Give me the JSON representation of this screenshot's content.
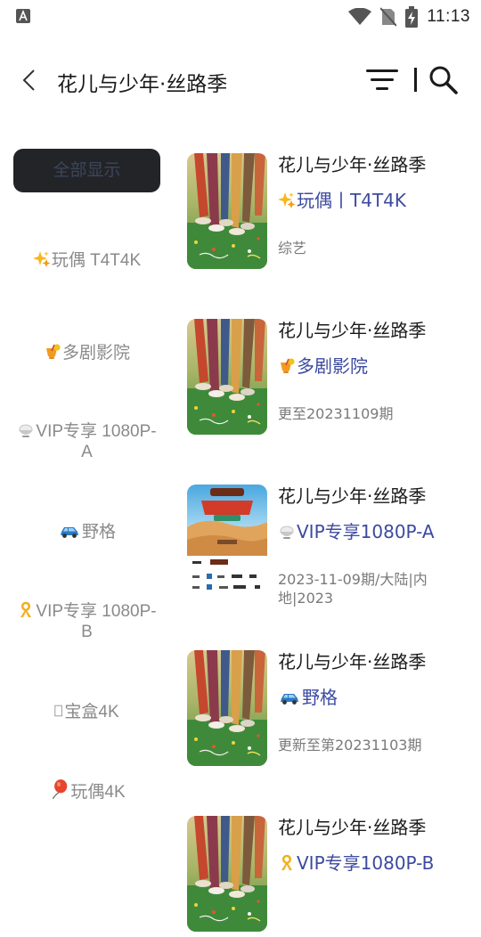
{
  "status_bar": {
    "time": "11:13"
  },
  "header": {
    "title": "花儿与少年·丝路季"
  },
  "sidebar": {
    "items": [
      {
        "label": "全部显示",
        "icon": "",
        "active": true
      },
      {
        "label": "玩偶 T4T4K",
        "icon": "sparkle-icon"
      },
      {
        "label": "多剧影院",
        "icon": "cocktail-icon"
      },
      {
        "label": "VIP专享 1080P-A",
        "icon": "rice-bowl-icon"
      },
      {
        "label": "野格",
        "icon": "car-icon"
      },
      {
        "label": "VIP专享 1080P-B",
        "icon": "ribbon-icon"
      },
      {
        "label": "宝盒4K",
        "icon": "missing-glyph-icon"
      },
      {
        "label": "玩偶4K",
        "icon": "balloon-icon"
      }
    ]
  },
  "results": [
    {
      "title": "花儿与少年·丝路季",
      "source": "玩偶丨T4T4K",
      "source_icon": "sparkle-icon",
      "meta": "综艺",
      "poster": "running-legs-poster"
    },
    {
      "title": "花儿与少年·丝路季",
      "source": "多剧影院",
      "source_icon": "cocktail-icon",
      "meta": "更至20231109期",
      "poster": "running-legs-poster"
    },
    {
      "title": "花儿与少年·丝路季",
      "source": "VIP专享1080P-A",
      "source_icon": "rice-bowl-icon",
      "meta": "2023-11-09期/大陆|内地|2023",
      "poster": "dove-desert-poster"
    },
    {
      "title": "花儿与少年·丝路季",
      "source": "野格",
      "source_icon": "car-icon",
      "meta": "更新至第20231103期",
      "poster": "running-legs-poster"
    },
    {
      "title": "花儿与少年·丝路季",
      "source": "VIP专享1080P-B",
      "source_icon": "ribbon-icon",
      "meta": "",
      "poster": "running-legs-poster"
    }
  ]
}
